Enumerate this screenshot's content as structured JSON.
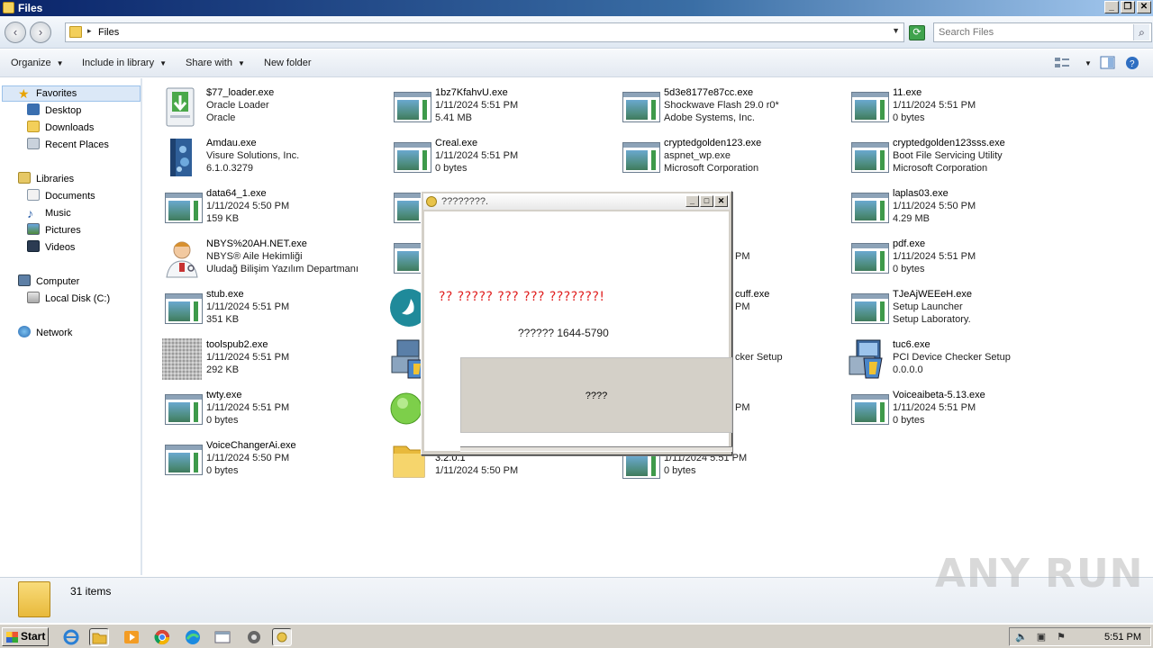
{
  "window": {
    "title": "Files"
  },
  "address": {
    "path": "Files"
  },
  "search": {
    "placeholder": "Search Files"
  },
  "toolbar": {
    "organize": "Organize",
    "include": "Include in library",
    "share": "Share with",
    "new_folder": "New folder"
  },
  "nav": {
    "favorites": "Favorites",
    "desktop": "Desktop",
    "downloads": "Downloads",
    "recent": "Recent Places",
    "libraries": "Libraries",
    "documents": "Documents",
    "music": "Music",
    "pictures": "Pictures",
    "videos": "Videos",
    "computer": "Computer",
    "localdisk": "Local Disk (C:)",
    "network": "Network"
  },
  "files": {
    "f1": {
      "name": "$77_loader.exe",
      "l2": "Oracle Loader",
      "l3": "Oracle"
    },
    "f2": {
      "name": "1bz7KfahvU.exe",
      "l2": "1/11/2024 5:51 PM",
      "l3": "5.41 MB"
    },
    "f3": {
      "name": "5d3e8177e87cc.exe",
      "l2": "Shockwave Flash 29.0 r0*",
      "l3": "Adobe Systems, Inc."
    },
    "f4": {
      "name": "11.exe",
      "l2": "1/11/2024 5:51 PM",
      "l3": "0 bytes"
    },
    "f5": {
      "name": "Amdau.exe",
      "l2": "Visure Solutions, Inc.",
      "l3": "6.1.0.3279"
    },
    "f6": {
      "name": "Creal.exe",
      "l2": "1/11/2024 5:51 PM",
      "l3": "0 bytes"
    },
    "f7": {
      "name": "cryptedgolden123.exe",
      "l2": "aspnet_wp.exe",
      "l3": "Microsoft Corporation"
    },
    "f8": {
      "name": "cryptedgolden123sss.exe",
      "l2": "Boot File Servicing Utility",
      "l3": "Microsoft Corporation"
    },
    "f9": {
      "name": "data64_1.exe",
      "l2": "1/11/2024 5:50 PM",
      "l3": "159 KB"
    },
    "f12": {
      "name": "laplas03.exe",
      "l2": "1/11/2024 5:50 PM",
      "l3": "4.29 MB"
    },
    "f13": {
      "name": "NBYS%20AH.NET.exe",
      "l2": "NBYS® Aile Hekimliği",
      "l3": "Uludağ Bilişim Yazılım Departmanı"
    },
    "f15": {
      "l2": "PM"
    },
    "f16": {
      "name": "pdf.exe",
      "l2": "1/11/2024 5:51 PM",
      "l3": "0 bytes"
    },
    "f17": {
      "name": "stub.exe",
      "l2": "1/11/2024 5:51 PM",
      "l3": "351 KB"
    },
    "f19": {
      "name": "cuff.exe",
      "l2": "PM"
    },
    "f20": {
      "name": "TJeAjWEEeH.exe",
      "l2": "Setup Launcher",
      "l3": "Setup Laboratory."
    },
    "f21": {
      "name": "toolspub2.exe",
      "l2": "1/11/2024 5:51 PM",
      "l3": "292 KB"
    },
    "f23": {
      "l2": "cker Setup"
    },
    "f24": {
      "name": "tuc6.exe",
      "l2": "PCI Device Checker Setup",
      "l3": "0.0.0.0"
    },
    "f25": {
      "name": "twty.exe",
      "l2": "1/11/2024 5:51 PM",
      "l3": "0 bytes"
    },
    "f27": {
      "l2": "PM"
    },
    "f28": {
      "name": "Voiceaibeta-5.13.exe",
      "l2": "1/11/2024 5:51 PM",
      "l3": "0 bytes"
    },
    "f29": {
      "name": "VoiceChangerAi.exe",
      "l2": "1/11/2024 5:50 PM",
      "l3": "0 bytes"
    },
    "f30": {
      "name": "3.2.0.1",
      "l2": "1/11/2024 5:50 PM"
    },
    "f31": {
      "name": "1/11/2024 5:51 PM",
      "l2": "0 bytes"
    }
  },
  "status": {
    "count": "31 items"
  },
  "dialog": {
    "title": "????????.",
    "message": "?? ????? ??? ??? ???????!",
    "phone": "?????? 1644-5790",
    "button": "????"
  },
  "watermark": "ANY RUN",
  "taskbar": {
    "start": "Start",
    "clock": "5:51 PM"
  }
}
